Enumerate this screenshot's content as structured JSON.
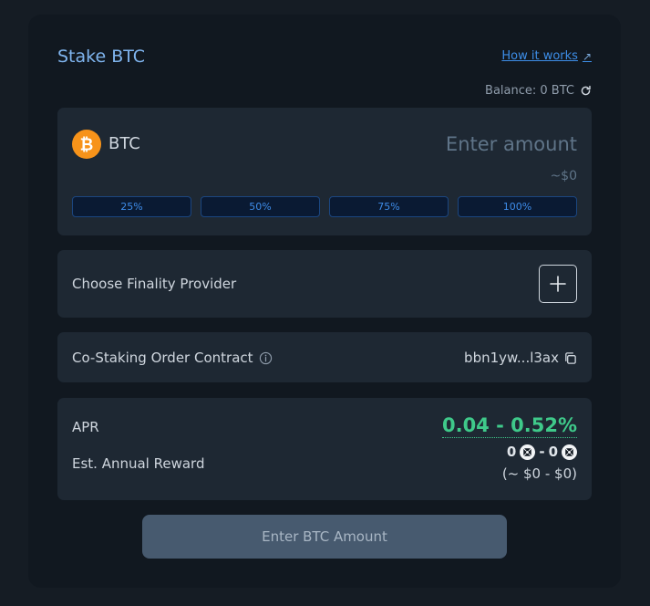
{
  "header": {
    "title": "Stake BTC",
    "how_it_works": "How it works",
    "balance": "Balance: 0 BTC"
  },
  "amount": {
    "asset": "BTC",
    "placeholder": "Enter amount",
    "usd_value": "~$0",
    "percent_options": [
      "25%",
      "50%",
      "75%",
      "100%"
    ]
  },
  "finality": {
    "label": "Choose Finality Provider"
  },
  "contract": {
    "label": "Co-Staking Order Contract",
    "address": "bbn1yw...l3ax"
  },
  "rewards": {
    "apr_label": "APR",
    "apr_value": "0.04 - 0.52%",
    "annual_label": "Est. Annual Reward",
    "reward_min": "0",
    "reward_sep": "-",
    "reward_max": "0",
    "reward_usd": "(~ $0 - $0)"
  },
  "submit_label": "Enter BTC Amount",
  "colors": {
    "accent": "#3d8ee8",
    "apr_green": "#3fc98a",
    "btc_orange": "#f7931a"
  },
  "icons": [
    "external-link-icon",
    "refresh-icon",
    "bitcoin-icon",
    "plus-icon",
    "info-icon",
    "copy-icon",
    "token-icon"
  ]
}
